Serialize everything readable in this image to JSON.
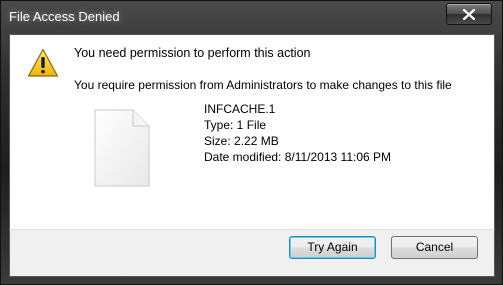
{
  "window": {
    "title": "File Access Denied"
  },
  "message": {
    "heading": "You need permission to perform this action",
    "detail": "You require permission from Administrators to make changes to this file"
  },
  "file": {
    "name": "INFCACHE.1",
    "type": "Type: 1 File",
    "size": "Size: 2.22 MB",
    "modified": "Date modified: 8/11/2013 11:06 PM"
  },
  "buttons": {
    "try_again": "Try Again",
    "cancel": "Cancel"
  },
  "icons": {
    "warning": "warning-icon",
    "file": "file-icon",
    "close": "close-icon"
  }
}
